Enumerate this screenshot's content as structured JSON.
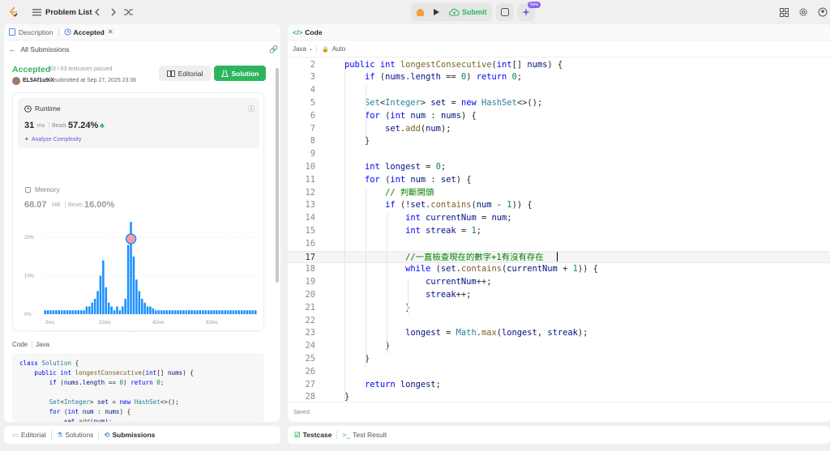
{
  "topbar": {
    "problem_list": "Problem List",
    "submit": "Submit",
    "new_badge": "New"
  },
  "left": {
    "tabs": [
      {
        "label": "Description"
      },
      {
        "label": "Accepted"
      }
    ],
    "all_submissions": "All Submissions",
    "status": "Accepted",
    "testcases": "83 / 83 testcases passed",
    "user": "EL5Af1u9iX",
    "submitted": "submitted at Sep 27, 2025 23:36",
    "editorial_btn": "Editorial",
    "solution_btn": "Solution",
    "runtime": {
      "label": "Runtime",
      "value": "31",
      "unit": "ms",
      "beats_label": "Beats",
      "beats": "57.24%",
      "analyze": "Analyze Complexity"
    },
    "memory": {
      "label": "Memory",
      "value": "68.07",
      "unit": "MB",
      "beats_label": "Beats",
      "beats": "16.00%"
    },
    "chart_data": {
      "type": "bar",
      "yticks": [
        "20%",
        "10%",
        "0%"
      ],
      "xticks": [
        "2ms",
        "22ms",
        "42ms",
        "62ms"
      ],
      "mini_xticks": [
        "2ms",
        "22ms",
        "42ms",
        "62ms"
      ],
      "values": [
        1,
        1,
        1,
        1,
        1,
        1,
        1,
        1,
        1,
        1,
        1,
        1,
        1,
        1,
        1,
        2,
        2,
        3,
        4,
        6,
        10,
        14,
        7,
        3,
        2,
        1,
        2,
        1,
        2,
        4,
        18,
        24,
        15,
        9,
        6,
        4,
        3,
        2,
        2,
        1.5,
        1,
        1,
        1,
        1,
        1,
        1,
        1,
        1,
        1,
        1,
        1,
        1,
        1,
        1,
        1,
        1,
        1,
        1,
        1,
        1,
        1,
        1,
        1,
        1,
        1,
        1,
        1,
        1,
        1,
        1,
        1,
        1,
        1,
        1,
        1,
        1,
        1
      ],
      "highlight_index": 31,
      "ylim": [
        0,
        20
      ]
    },
    "code_header": {
      "label": "Code",
      "lang": "Java"
    },
    "code_lines": [
      "class Solution {",
      "    public int longestConsecutive(int[] nums) {",
      "        if (nums.length == 0) return 0;",
      "",
      "        Set<Integer> set = new HashSet<>();",
      "        for (int num : nums) {",
      "            set.add(num);"
    ],
    "bottom_tabs": [
      {
        "label": "Editorial"
      },
      {
        "label": "Solutions"
      },
      {
        "label": "Submissions"
      }
    ]
  },
  "right": {
    "tab": "Code",
    "lang": "Java",
    "auto": "Auto",
    "saved": "Saved",
    "lines": [
      {
        "n": "2",
        "t": "    public int longestConsecutive(int[] nums) {"
      },
      {
        "n": "3",
        "t": "        if (nums.length == 0) return 0;"
      },
      {
        "n": "4",
        "t": ""
      },
      {
        "n": "5",
        "t": "        Set<Integer> set = new HashSet<>();"
      },
      {
        "n": "6",
        "t": "        for (int num : nums) {"
      },
      {
        "n": "7",
        "t": "            set.add(num);"
      },
      {
        "n": "8",
        "t": "        }"
      },
      {
        "n": "9",
        "t": ""
      },
      {
        "n": "10",
        "t": "        int longest = 0;"
      },
      {
        "n": "11",
        "t": "        for (int num : set) {"
      },
      {
        "n": "12",
        "t": "            // 判斷開頭"
      },
      {
        "n": "13",
        "t": "            if (!set.contains(num - 1)) {"
      },
      {
        "n": "14",
        "t": "                int currentNum = num;"
      },
      {
        "n": "15",
        "t": "                int streak = 1;"
      },
      {
        "n": "16",
        "t": ""
      },
      {
        "n": "17",
        "t": "                //一直檢查現在的數字+1有沒有存在"
      },
      {
        "n": "18",
        "t": "                while (set.contains(currentNum + 1)) {"
      },
      {
        "n": "19",
        "t": "                    currentNum++;"
      },
      {
        "n": "20",
        "t": "                    streak++;"
      },
      {
        "n": "21",
        "t": "                }"
      },
      {
        "n": "22",
        "t": ""
      },
      {
        "n": "23",
        "t": "                longest = Math.max(longest, streak);"
      },
      {
        "n": "24",
        "t": "            }"
      },
      {
        "n": "25",
        "t": "        }"
      },
      {
        "n": "26",
        "t": ""
      },
      {
        "n": "27",
        "t": "        return longest;"
      },
      {
        "n": "28",
        "t": "    }"
      }
    ],
    "bottom_tabs": [
      {
        "label": "Testcase"
      },
      {
        "label": "Test Result"
      }
    ]
  },
  "colors": {
    "accent_green": "#2db55d",
    "accepted": "#2db55d",
    "highlight_line": "#f5f5f5",
    "bar": "#1a90ff"
  }
}
